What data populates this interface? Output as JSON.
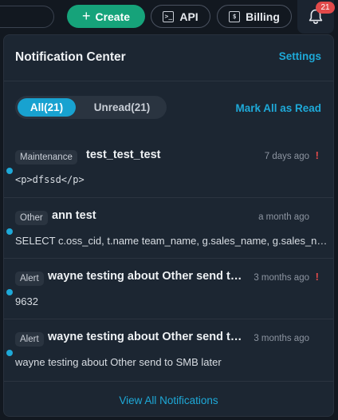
{
  "topbar": {
    "create_label": "Create",
    "api_label": "API",
    "billing_label": "Billing",
    "notification_count": "21"
  },
  "panel": {
    "title": "Notification Center",
    "settings_label": "Settings",
    "tabs": [
      {
        "label": "All(21)",
        "active": true
      },
      {
        "label": "Unread(21)",
        "active": false
      }
    ],
    "mark_all_label": "Mark All as Read",
    "view_all_label": "View All Notifications"
  },
  "notifications": [
    {
      "tag": "Maintenance",
      "title": "test_test_test",
      "time": "7 days ago",
      "important": "!",
      "body": "<p>dfssd</p>",
      "unread": true
    },
    {
      "tag": "Other",
      "title": "ann test",
      "time": "a month ago",
      "important": "",
      "body": "SELECT c.oss_cid, t.name team_name, g.sales_name, g.sales_name",
      "unread": true
    },
    {
      "tag": "Alert",
      "title": "wayne testing about Other send to SMB later",
      "time": "3 months ago",
      "important": "!",
      "body": "9632",
      "unread": true
    },
    {
      "tag": "Alert",
      "title": "wayne testing about Other send to SMB later",
      "time": "3 months ago",
      "important": "",
      "body": "wayne testing about Other send to SMB later",
      "unread": true
    }
  ],
  "colors": {
    "accent": "#1ea9d8",
    "create": "#16a37a",
    "badge": "#e24a4a",
    "panel_bg": "#1c2632"
  },
  "icons": {
    "create": "plus-icon",
    "api": "terminal-icon",
    "billing": "dollar-icon",
    "notifications": "bell-icon"
  }
}
